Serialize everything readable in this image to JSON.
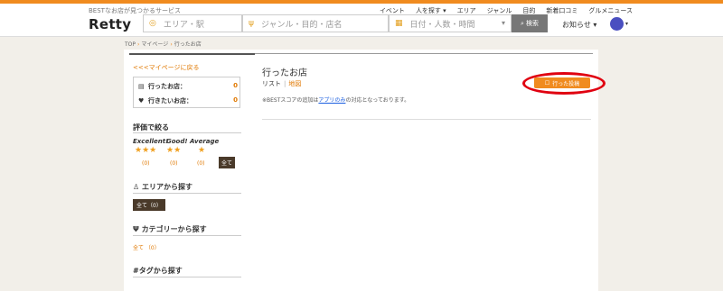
{
  "header": {
    "tagline": "BESTなお店が見つかるサービス",
    "logo": "Retty",
    "nav": [
      "イベント",
      "人を探す ▾",
      "エリア",
      "ジャンル",
      "目的",
      "新着口コミ",
      "グルメニュース"
    ],
    "search": {
      "area_placeholder": "エリア・駅",
      "genre_placeholder": "ジャンル・目的・店名",
      "date_placeholder": "日付・人数・時間",
      "button_label": "検索"
    },
    "notice_label": "お知らせ ▾"
  },
  "breadcrumb": [
    "TOP",
    "マイページ",
    "行ったお店"
  ],
  "sidebar": {
    "back_link": "<<<マイページに戻る",
    "counts": [
      {
        "label": "行ったお店：",
        "value": "0"
      },
      {
        "label": "行きたいお店：",
        "value": "0"
      }
    ],
    "rating_section": {
      "title": "評価で絞る",
      "ratings": [
        {
          "label": "Excellent!",
          "stars": "★★★",
          "count": "(0)"
        },
        {
          "label": "Good!",
          "stars": "★★",
          "count": "(0)"
        },
        {
          "label": "Average",
          "stars": "★",
          "count": "(0)"
        }
      ],
      "all_label": "全て"
    },
    "area_section": {
      "title": "エリアから探す",
      "chip": "全て（0）"
    },
    "category_section": {
      "title": "カテゴリーから探す",
      "chip": "全て （0）"
    },
    "tag_section": {
      "title": "#タグから探す"
    }
  },
  "main": {
    "title": "行ったお店",
    "tabs": [
      "リスト",
      "地図"
    ],
    "note_prefix": "※BESTスコアの追加は",
    "note_link": "アプリのみ",
    "note_suffix": "の対応となっております。",
    "went_button": "行った投稿"
  },
  "colors": {
    "accent": "#f08b1f",
    "link_orange": "#e07800",
    "highlight_ring": "#e00010",
    "avatar": "#4a4fc0"
  }
}
